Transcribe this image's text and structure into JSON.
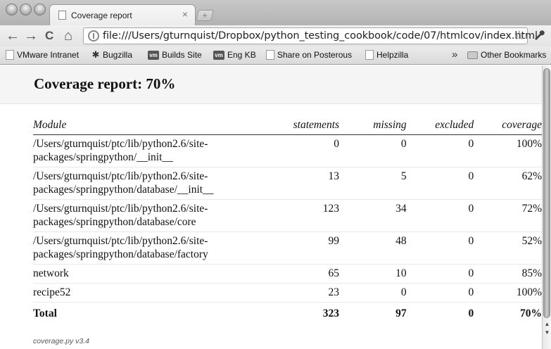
{
  "browser": {
    "tab_title": "Coverage report",
    "tab_close": "×",
    "new_tab": "+",
    "url": "file:///Users/gturnquist/Dropbox/python_testing_cookbook/code/07/htmlcov/index.html",
    "nav": {
      "back": "←",
      "forward": "→",
      "reload": "C",
      "home": "⌂",
      "bookmark_star": "☆",
      "wrench": "🔧"
    },
    "bookmarks": [
      {
        "label": "VMware Intranet",
        "icon": "page-icon"
      },
      {
        "label": "Bugzilla",
        "icon": "bug-icon"
      },
      {
        "label": "Builds Site",
        "icon": "vm-icon"
      },
      {
        "label": "Eng KB",
        "icon": "vm-icon"
      },
      {
        "label": "Share on Posterous",
        "icon": "page-icon"
      },
      {
        "label": "Helpzilla",
        "icon": "page-icon"
      }
    ],
    "bookmarks_overflow": "»",
    "other_bookmarks": "Other Bookmarks",
    "vm_icon_text": "vm"
  },
  "report": {
    "title": "Coverage report: 70%",
    "columns": {
      "module": "Module",
      "statements": "statements",
      "missing": "missing",
      "excluded": "excluded",
      "coverage": "coverage"
    },
    "rows": [
      {
        "module": "/Users/gturnquist/ptc/lib/python2.6/site-packages/springpython/__init__",
        "statements": "0",
        "missing": "0",
        "excluded": "0",
        "coverage": "100%"
      },
      {
        "module": "/Users/gturnquist/ptc/lib/python2.6/site-packages/springpython/database/__init__",
        "statements": "13",
        "missing": "5",
        "excluded": "0",
        "coverage": "62%"
      },
      {
        "module": "/Users/gturnquist/ptc/lib/python2.6/site-packages/springpython/database/core",
        "statements": "123",
        "missing": "34",
        "excluded": "0",
        "coverage": "72%"
      },
      {
        "module": "/Users/gturnquist/ptc/lib/python2.6/site-packages/springpython/database/factory",
        "statements": "99",
        "missing": "48",
        "excluded": "0",
        "coverage": "52%"
      },
      {
        "module": "network",
        "statements": "65",
        "missing": "10",
        "excluded": "0",
        "coverage": "85%"
      },
      {
        "module": "recipe52",
        "statements": "23",
        "missing": "0",
        "excluded": "0",
        "coverage": "100%"
      }
    ],
    "total": {
      "module": "Total",
      "statements": "323",
      "missing": "97",
      "excluded": "0",
      "coverage": "70%"
    },
    "footer": "coverage.py v3.4"
  }
}
